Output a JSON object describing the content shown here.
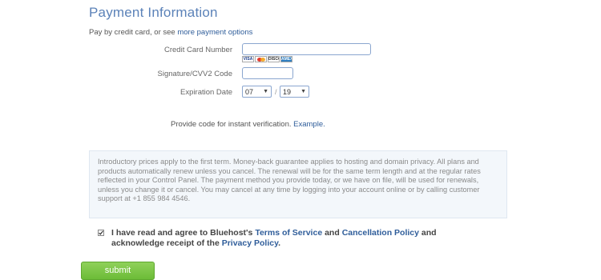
{
  "section": {
    "title": "Payment Information",
    "pay_by_prefix": "Pay by credit card, or see ",
    "pay_by_link": "more payment options"
  },
  "form": {
    "card_number_label": "Credit Card Number",
    "card_number_value": "",
    "card_logos": [
      "VISA",
      "MasterCard",
      "DISCOVER",
      "AMEX"
    ],
    "cvv_label": "Signature/CVV2 Code",
    "cvv_value": "",
    "expiration_label": "Expiration Date",
    "expiration_month": "07",
    "expiration_year": "19",
    "expiration_separator": "/"
  },
  "verification": {
    "text": "Provide code for instant verification. ",
    "link": "Example."
  },
  "notice": {
    "text": "Introductory prices apply to the first term. Money-back guarantee applies to hosting and domain privacy. All plans and products automatically renew unless you cancel. The renewal will be for the same term length and at the regular rates reflected in your Control Panel. The payment method you provide today, or we have on file, will be used for renewals, unless you change it or cancel. You may cancel at any time by logging into your account online or by calling customer support at +1 855 984 4546."
  },
  "agreement": {
    "checked": true,
    "prefix": "I have read and agree to Bluehost's ",
    "terms_link": "Terms of Service",
    "and_1": " and ",
    "cancellation_link": "Cancellation Policy",
    "and_2": " and acknowledge receipt of the ",
    "privacy_link": "Privacy Policy",
    "suffix": "."
  },
  "actions": {
    "submit_label": "submit"
  },
  "colors": {
    "title": "#5b82b8",
    "link": "#2f5d9a",
    "submit": "#7cc644",
    "notice_bg": "#f3f7fb"
  }
}
